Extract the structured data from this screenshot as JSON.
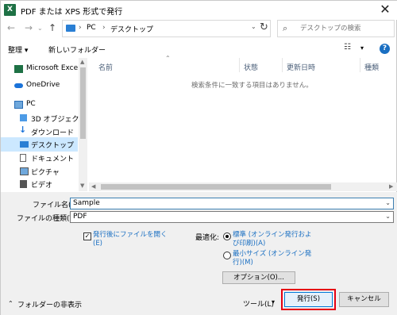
{
  "window": {
    "title": "PDF または XPS 形式で発行",
    "app_icon": "X"
  },
  "address": {
    "crumbs": [
      "PC",
      "デスクトップ"
    ],
    "separator": "›"
  },
  "search": {
    "placeholder": "デスクトップの検索"
  },
  "toolbar": {
    "organize": "整理 ▾",
    "new_folder": "新しいフォルダー",
    "help": "?"
  },
  "nav": {
    "items": [
      {
        "label": "Microsoft Excel",
        "icon": "excel-icon"
      },
      {
        "label": "OneDrive",
        "icon": "cloud-icon"
      },
      {
        "label": "PC",
        "icon": "computer-icon"
      },
      {
        "label": "3D オブジェクト",
        "icon": "cube-icon"
      },
      {
        "label": "ダウンロード",
        "icon": "download-arrow-icon"
      },
      {
        "label": "デスクトップ",
        "icon": "desktop-icon",
        "selected": true
      },
      {
        "label": "ドキュメント",
        "icon": "document-icon"
      },
      {
        "label": "ピクチャ",
        "icon": "picture-icon"
      },
      {
        "label": "ビデオ",
        "icon": "video-icon"
      }
    ]
  },
  "filelist": {
    "columns": [
      "名前",
      "状態",
      "更新日時",
      "種類"
    ],
    "empty_message": "検索条件に一致する項目はありません。"
  },
  "form": {
    "filename_label": "ファイル名(N):",
    "filename_value": "Sample",
    "filetype_label": "ファイルの種類(T):",
    "filetype_value": "PDF",
    "open_after_publish_line1": "発行後にファイルを開く",
    "open_after_publish_line2": "(E)",
    "optimize_label": "最適化:",
    "opt_standard_line1": "標準 (オンライン発行およ",
    "opt_standard_line2": "び印刷)(A)",
    "opt_min_line1": "最小サイズ (オンライン発",
    "opt_min_line2": "行)(M)",
    "options_button": "オプション(O)...",
    "hide_folders": "フォルダーの非表示",
    "tools": "ツール(L)",
    "publish": "発行(S)",
    "cancel": "キャンセル"
  },
  "colors": {
    "accent": "#0078d7",
    "highlight": "#e60012",
    "selection": "#cce8ff"
  }
}
